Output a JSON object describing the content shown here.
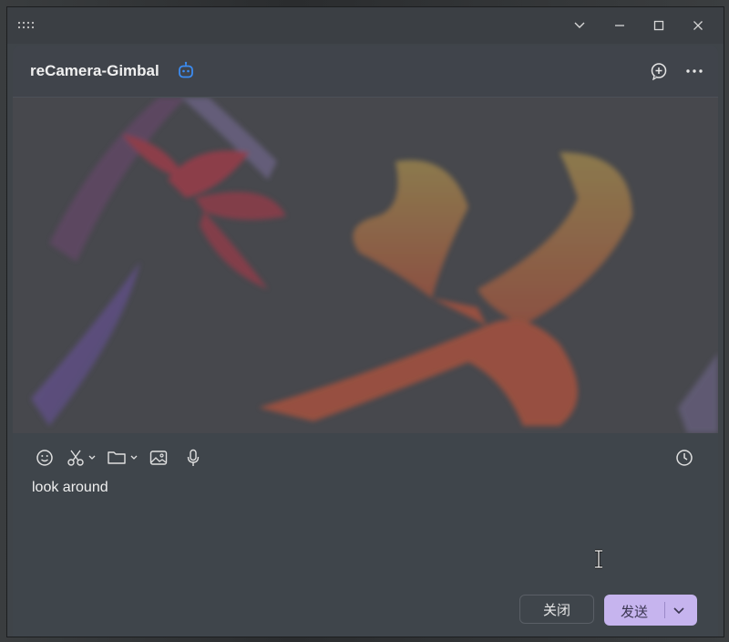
{
  "window": {
    "controls": [
      "chevron-down-icon",
      "minimize-icon",
      "maximize-icon",
      "close-icon"
    ]
  },
  "header": {
    "title": "reCamera-Gimbal",
    "bot_icon": "robot-icon",
    "actions": [
      "add-circle-icon",
      "more-icon"
    ]
  },
  "toolbar": {
    "tools": [
      "emoji-icon",
      "scissors-icon",
      "folder-icon",
      "image-icon",
      "microphone-icon"
    ],
    "history_icon": "clock-icon"
  },
  "compose": {
    "text": "look around"
  },
  "buttons": {
    "close_label": "关闭",
    "send_label": "发送"
  },
  "colors": {
    "accent": "#c6b4ee",
    "bot_icon": "#3b8cf2",
    "panel": "#3f454b"
  }
}
